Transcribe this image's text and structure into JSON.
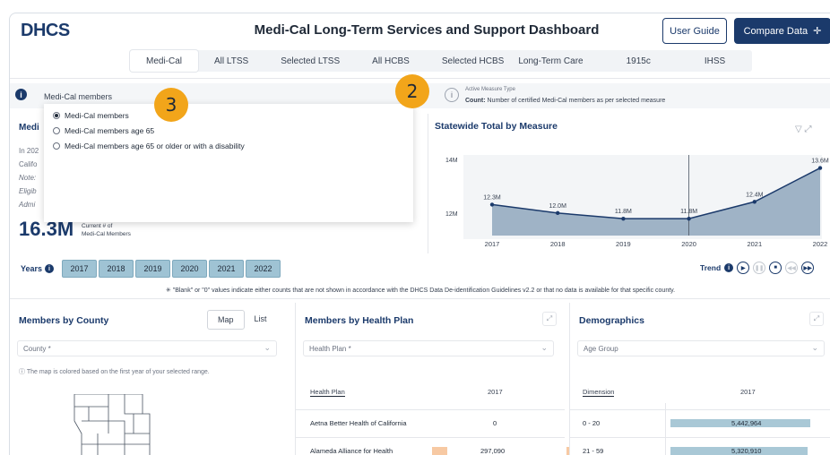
{
  "header": {
    "logo_text": "DHCS",
    "title": "Medi-Cal Long-Term Services and Support Dashboard",
    "user_guide_label": "User Guide",
    "compare_label": "Compare Data",
    "compare_icon": "plus-icon"
  },
  "tabs": [
    {
      "label": "Medi-Cal",
      "active": true
    },
    {
      "label": "All LTSS"
    },
    {
      "label": "Selected LTSS"
    },
    {
      "label": "All HCBS"
    },
    {
      "label": "Selected HCBS"
    },
    {
      "label": "Long-Term Care"
    },
    {
      "label": "1915c"
    },
    {
      "label": "IHSS"
    }
  ],
  "measure": {
    "selected": "Medi-Cal members",
    "options": [
      {
        "label": "Medi-Cal members",
        "selected": true
      },
      {
        "label": "Medi-Cal members age 65"
      },
      {
        "label": "Medi-Cal members age 65 or older or with a disability"
      }
    ]
  },
  "active_measure": {
    "label": "Active Measure Type",
    "bold": "Count:",
    "text": "Number of certified Medi-Cal members as per selected measure"
  },
  "summary": {
    "title": "Medi",
    "lines": [
      "In 202",
      "Califo",
      "Note:",
      "Eligib",
      "Admi"
    ],
    "big_value": "16.3M",
    "big_label_1": "Current # of",
    "big_label_2": "Medi-Cal Members"
  },
  "chart_data": {
    "type": "area",
    "title": "Statewide Total by Measure",
    "x": [
      "2017",
      "2018",
      "2019",
      "2020",
      "2021",
      "2022"
    ],
    "values": [
      12.3,
      12.0,
      11.8,
      11.8,
      12.4,
      13.6
    ],
    "labels": [
      "12.3M",
      "12.0M",
      "11.8M",
      "11.8M",
      "12.4M",
      "13.6M"
    ],
    "yticks": [
      "14M",
      "12M"
    ],
    "ylim": [
      11.2,
      14.0
    ],
    "color": "#9fb3c6",
    "line_color": "#1b3a6b"
  },
  "years": {
    "label": "Years",
    "items": [
      "2017",
      "2018",
      "2019",
      "2020",
      "2021",
      "2022"
    ],
    "trend_label": "Trend"
  },
  "disclaimer": "\"Blank\" or \"0\" values indicate either counts that are not shown in accordance with the DHCS Data De-identification Guidelines v2.2 or that no data is available for that specific county.",
  "county_panel": {
    "title": "Members by County",
    "toggle_map": "Map",
    "toggle_list": "List",
    "placeholder": "County *",
    "note": "The map is colored based on the first year of your selected range."
  },
  "plan_panel": {
    "title": "Members by Health Plan",
    "placeholder": "Health Plan *",
    "col_plan": "Health Plan",
    "col_year": "2017",
    "rows": [
      {
        "plan": "Aetna Better Health of California",
        "value": "0",
        "bar": 0
      },
      {
        "plan": "Alameda Alliance for Health",
        "value": "297,090",
        "bar": 0.055
      }
    ]
  },
  "demo_panel": {
    "title": "Demographics",
    "placeholder": "Age Group",
    "col_dim": "Dimension",
    "col_year": "2017",
    "rows": [
      {
        "dim": "0 - 20",
        "value": "5,442,964",
        "bar": 1.0
      },
      {
        "dim": "21 - 59",
        "value": "5,320,910",
        "bar": 0.98
      }
    ]
  },
  "badges": [
    "2",
    "3"
  ]
}
